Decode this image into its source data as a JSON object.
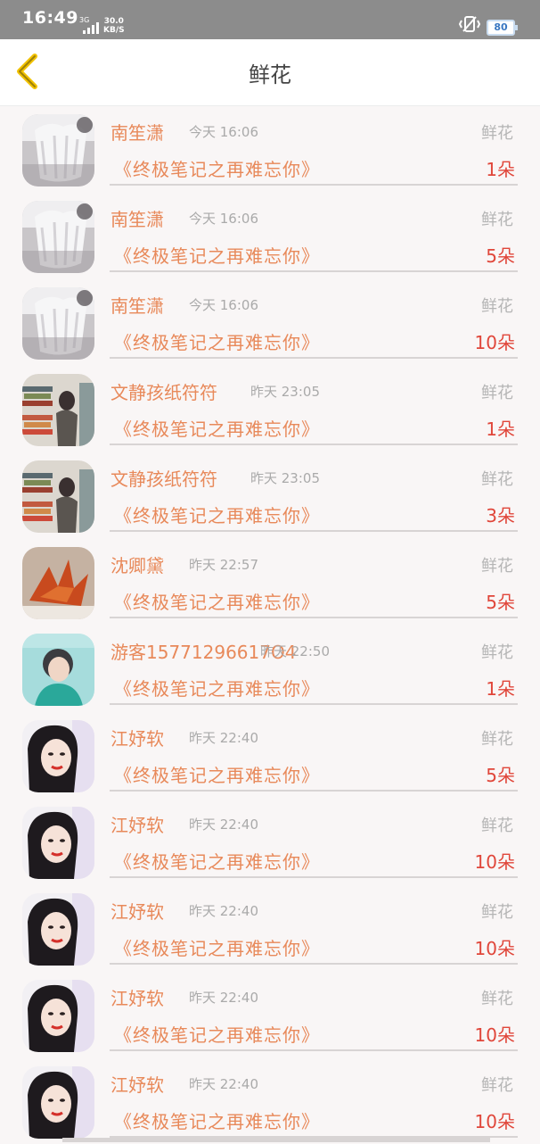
{
  "status_bar": {
    "time": "16:49",
    "network": "3G",
    "speed_value": "30.0",
    "speed_unit": "KB/S",
    "battery": "80"
  },
  "header": {
    "title": "鲜花",
    "back_icon": "chevron-left-icon"
  },
  "rows": [
    {
      "name": "南笙潇",
      "time": "今天 16:06",
      "gift": "鲜花",
      "book": "《终极笔记之再难忘你》",
      "count": "1朵",
      "avatar": "photo-white-dress"
    },
    {
      "name": "南笙潇",
      "time": "今天 16:06",
      "gift": "鲜花",
      "book": "《终极笔记之再难忘你》",
      "count": "5朵",
      "avatar": "photo-white-dress"
    },
    {
      "name": "南笙潇",
      "time": "今天 16:06",
      "gift": "鲜花",
      "book": "《终极笔记之再难忘你》",
      "count": "10朵",
      "avatar": "photo-white-dress"
    },
    {
      "name": "文静孩纸符符",
      "time": "昨天 23:05",
      "gift": "鲜花",
      "book": "《终极笔记之再难忘你》",
      "count": "1朵",
      "avatar": "photo-store-shelf"
    },
    {
      "name": "文静孩纸符符",
      "time": "昨天 23:05",
      "gift": "鲜花",
      "book": "《终极笔记之再难忘你》",
      "count": "3朵",
      "avatar": "photo-store-shelf"
    },
    {
      "name": "沈卿黛",
      "time": "昨天 22:57",
      "gift": "鲜花",
      "book": "《终极笔记之再难忘你》",
      "count": "5朵",
      "avatar": "photo-paper-crane"
    },
    {
      "name": "游客15771296617O4",
      "time": "昨天 22:50",
      "gift": "鲜花",
      "book": "《终极笔记之再难忘你》",
      "count": "1朵",
      "avatar": "photo-teal-portrait"
    },
    {
      "name": "江妤软",
      "time": "昨天 22:40",
      "gift": "鲜花",
      "book": "《终极笔记之再难忘你》",
      "count": "5朵",
      "avatar": "photo-girl-portrait"
    },
    {
      "name": "江妤软",
      "time": "昨天 22:40",
      "gift": "鲜花",
      "book": "《终极笔记之再难忘你》",
      "count": "10朵",
      "avatar": "photo-girl-portrait"
    },
    {
      "name": "江妤软",
      "time": "昨天 22:40",
      "gift": "鲜花",
      "book": "《终极笔记之再难忘你》",
      "count": "10朵",
      "avatar": "photo-girl-portrait"
    },
    {
      "name": "江妤软",
      "time": "昨天 22:40",
      "gift": "鲜花",
      "book": "《终极笔记之再难忘你》",
      "count": "10朵",
      "avatar": "photo-girl-portrait"
    },
    {
      "name": "江妤软",
      "time": "昨天 22:40",
      "gift": "鲜花",
      "book": "《终极笔记之再难忘你》",
      "count": "10朵",
      "avatar": "photo-girl-portrait"
    }
  ],
  "colors": {
    "accent": "#e8895a",
    "count": "#e0463a",
    "muted": "#aaaaaa",
    "back_arrow": "#f2c200"
  }
}
